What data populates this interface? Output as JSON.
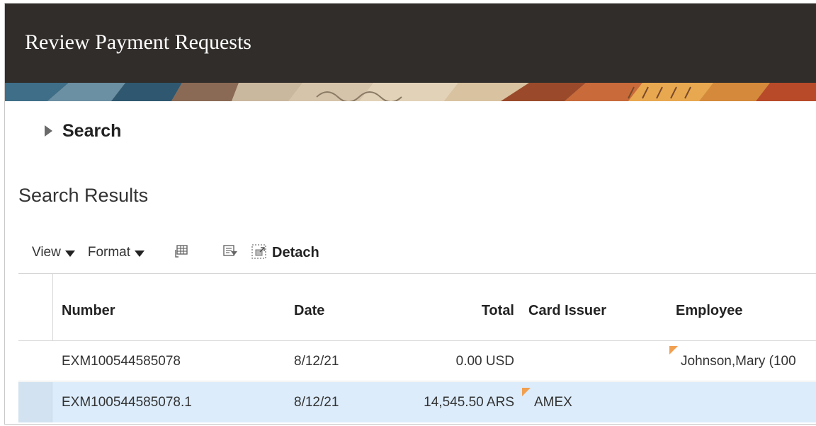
{
  "page": {
    "title": "Review Payment Requests",
    "search_label": "Search",
    "results_title": "Search Results"
  },
  "toolbar": {
    "view_label": "View",
    "format_label": "Format",
    "freeze_icon": "freeze-columns-icon",
    "wrap_icon": "wrap-filter-icon",
    "detach_icon": "detach-icon",
    "detach_label": "Detach"
  },
  "table": {
    "columns": [
      "Number",
      "Date",
      "Total",
      "Card Issuer",
      "Employee"
    ],
    "rows": [
      {
        "number": "EXM100544585078",
        "date": "8/12/21",
        "total": "0.00 USD",
        "card_issuer": "",
        "employee": "Johnson,Mary (100",
        "selected": false
      },
      {
        "number": "EXM100544585078.1",
        "date": "8/12/21",
        "total": "14,545.50 ARS",
        "card_issuer": "AMEX",
        "employee": "",
        "selected": true
      }
    ]
  },
  "colors": {
    "header_bg": "#312d2a",
    "selected_row": "#dcecfb",
    "flag": "#f0a050"
  }
}
